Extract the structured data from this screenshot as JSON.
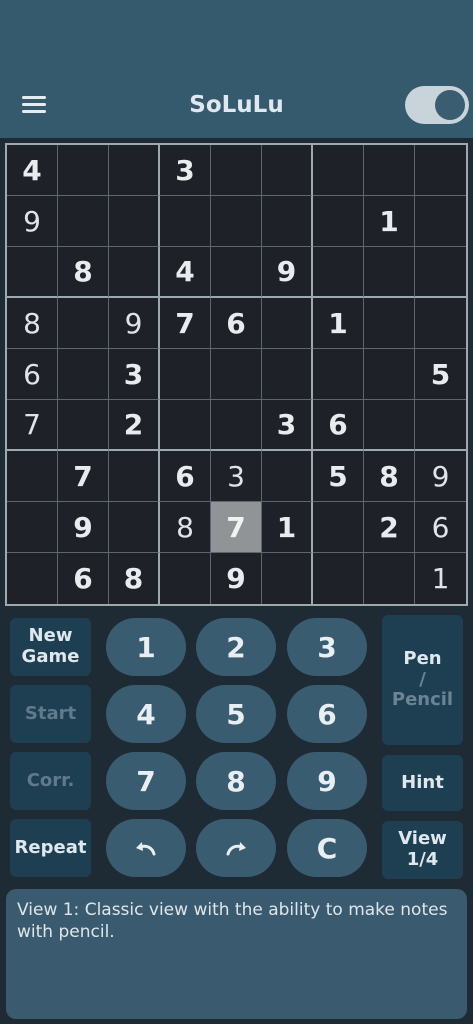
{
  "header": {
    "title": "SoLuLu",
    "menu_icon": "hamburger-menu-icon",
    "toggle_on": true
  },
  "grid": {
    "rows": [
      [
        {
          "v": "4",
          "g": true
        },
        {
          "v": "",
          "g": false
        },
        {
          "v": "",
          "g": false
        },
        {
          "v": "3",
          "g": true
        },
        {
          "v": "",
          "g": false
        },
        {
          "v": "",
          "g": false
        },
        {
          "v": "",
          "g": false
        },
        {
          "v": "",
          "g": false
        },
        {
          "v": "",
          "g": false
        }
      ],
      [
        {
          "v": "9",
          "g": false
        },
        {
          "v": "",
          "g": false
        },
        {
          "v": "",
          "g": false
        },
        {
          "v": "",
          "g": false
        },
        {
          "v": "",
          "g": false
        },
        {
          "v": "",
          "g": false
        },
        {
          "v": "",
          "g": false
        },
        {
          "v": "1",
          "g": true
        },
        {
          "v": "",
          "g": false
        }
      ],
      [
        {
          "v": "",
          "g": false
        },
        {
          "v": "8",
          "g": true
        },
        {
          "v": "",
          "g": false
        },
        {
          "v": "4",
          "g": true
        },
        {
          "v": "",
          "g": false
        },
        {
          "v": "9",
          "g": true
        },
        {
          "v": "",
          "g": false
        },
        {
          "v": "",
          "g": false
        },
        {
          "v": "",
          "g": false
        }
      ],
      [
        {
          "v": "8",
          "g": false
        },
        {
          "v": "",
          "g": false
        },
        {
          "v": "9",
          "g": false
        },
        {
          "v": "7",
          "g": true
        },
        {
          "v": "6",
          "g": true
        },
        {
          "v": "",
          "g": false
        },
        {
          "v": "1",
          "g": true
        },
        {
          "v": "",
          "g": false
        },
        {
          "v": "",
          "g": false
        }
      ],
      [
        {
          "v": "6",
          "g": false
        },
        {
          "v": "",
          "g": false
        },
        {
          "v": "3",
          "g": true
        },
        {
          "v": "",
          "g": false
        },
        {
          "v": "",
          "g": false
        },
        {
          "v": "",
          "g": false
        },
        {
          "v": "",
          "g": false
        },
        {
          "v": "",
          "g": false
        },
        {
          "v": "5",
          "g": true
        }
      ],
      [
        {
          "v": "7",
          "g": false
        },
        {
          "v": "",
          "g": false
        },
        {
          "v": "2",
          "g": true
        },
        {
          "v": "",
          "g": false
        },
        {
          "v": "",
          "g": false
        },
        {
          "v": "3",
          "g": true
        },
        {
          "v": "6",
          "g": true
        },
        {
          "v": "",
          "g": false
        },
        {
          "v": "",
          "g": false
        }
      ],
      [
        {
          "v": "",
          "g": false
        },
        {
          "v": "7",
          "g": true
        },
        {
          "v": "",
          "g": false
        },
        {
          "v": "6",
          "g": true
        },
        {
          "v": "3",
          "g": false
        },
        {
          "v": "",
          "g": false
        },
        {
          "v": "5",
          "g": true
        },
        {
          "v": "8",
          "g": true
        },
        {
          "v": "9",
          "g": false
        }
      ],
      [
        {
          "v": "",
          "g": false
        },
        {
          "v": "9",
          "g": true
        },
        {
          "v": "",
          "g": false
        },
        {
          "v": "8",
          "g": false
        },
        {
          "v": "7",
          "g": true,
          "sel": true
        },
        {
          "v": "1",
          "g": true
        },
        {
          "v": "",
          "g": false
        },
        {
          "v": "2",
          "g": true
        },
        {
          "v": "6",
          "g": false
        }
      ],
      [
        {
          "v": "",
          "g": false
        },
        {
          "v": "6",
          "g": true
        },
        {
          "v": "8",
          "g": true
        },
        {
          "v": "",
          "g": false
        },
        {
          "v": "9",
          "g": true
        },
        {
          "v": "",
          "g": false
        },
        {
          "v": "",
          "g": false
        },
        {
          "v": "",
          "g": false
        },
        {
          "v": "1",
          "g": false
        }
      ]
    ]
  },
  "controls": {
    "new_game": "New Game",
    "start": "Start",
    "corr": "Corr.",
    "repeat": "Repeat",
    "numbers": [
      "1",
      "2",
      "3",
      "4",
      "5",
      "6",
      "7",
      "8",
      "9"
    ],
    "undo_icon": "undo-icon",
    "redo_icon": "redo-icon",
    "clear": "C",
    "pen": "Pen",
    "slash": "/",
    "pencil": "Pencil",
    "hint": "Hint",
    "view": "View 1/4"
  },
  "info": {
    "text": "View 1: Classic view with the ability to make notes with pencil."
  },
  "colors": {
    "header_bg": "#35596d",
    "board_bg": "#1e2128",
    "button_bg": "#1e3f52",
    "pill_bg": "#395c70",
    "info_bg": "#3a5b6f",
    "selected_cell": "#909497"
  }
}
